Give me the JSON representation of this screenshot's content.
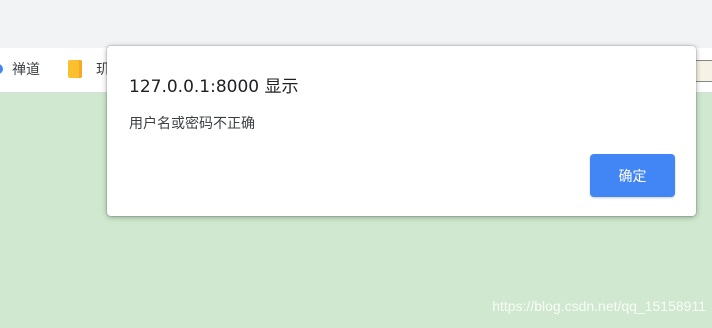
{
  "browser": {
    "bookmarks": [
      {
        "label": "禅道",
        "icon": "bookmark-dot"
      },
      {
        "label": "玑",
        "icon": "folder-icon"
      }
    ]
  },
  "dialog": {
    "title": "127.0.0.1:8000 显示",
    "message": "用户名或密码不正确",
    "ok_label": "确定",
    "ok_color": "#4285f4"
  },
  "page": {
    "background_color": "#cfe8cf",
    "watermark": "https://blog.csdn.net/qq_15158911"
  }
}
